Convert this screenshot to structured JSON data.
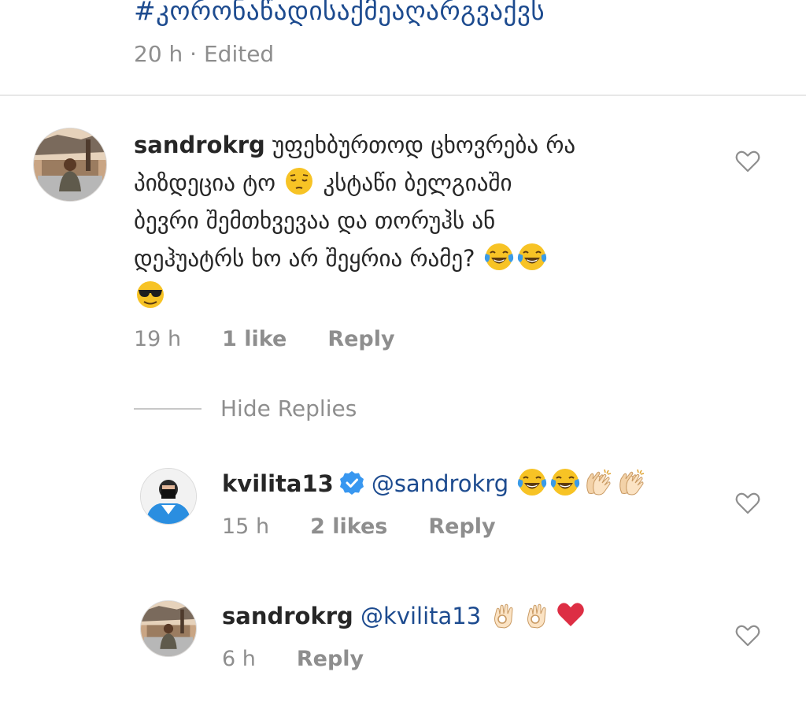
{
  "caption": {
    "hashtag": "#კორონაწადისაქმეაღარგვაქვს",
    "meta": "20 h · Edited"
  },
  "comments": [
    {
      "username": "sandrokrg",
      "text_line1": "უფეხბურთოდ ცხოვრება რა",
      "text_line2a": "პიზდეცია ტო",
      "text_line2b": "კსტაწი ბელგიაში",
      "text_line3": "ბევრი შემთხვევაა და თორუჰს ან",
      "text_line4": "დეჰუატრს ხო არ შეყრია რამე?",
      "time": "19 h",
      "likes": "1 like",
      "reply": "Reply",
      "emojis": [
        "pensive-face",
        "tears-of-joy",
        "tears-of-joy",
        "smiling-face-with-sunglasses"
      ]
    }
  ],
  "hide_replies": "Hide Replies",
  "replies": [
    {
      "username": "kvilita13",
      "verified": true,
      "mention": "@sandrokrg",
      "time": "15 h",
      "likes": "2 likes",
      "reply": "Reply",
      "emojis": [
        "tears-of-joy",
        "tears-of-joy",
        "clapping-hands",
        "clapping-hands"
      ]
    },
    {
      "username": "sandrokrg",
      "verified": false,
      "mention": "@kvilita13",
      "time": "6 h",
      "reply": "Reply",
      "emojis": [
        "ok-hand",
        "ok-hand",
        "red-heart"
      ]
    }
  ],
  "colors": {
    "link": "#1d4b8f",
    "meta": "#8e8e8e",
    "verified": "#3897f0",
    "heart_outline": "#8e8e8e"
  }
}
